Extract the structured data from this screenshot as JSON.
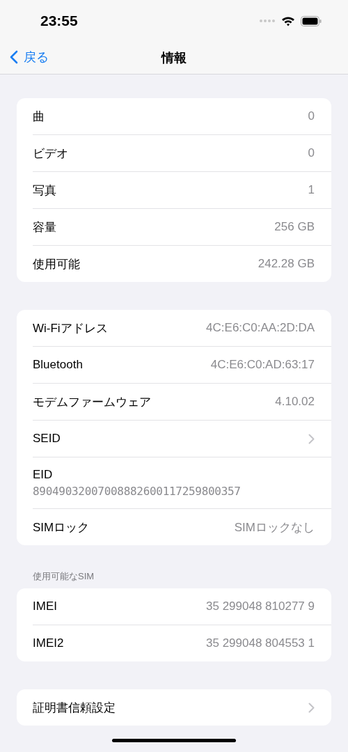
{
  "status_bar": {
    "time": "23:55"
  },
  "nav": {
    "back": "戻る",
    "title": "情報"
  },
  "groups": [
    {
      "rows": [
        {
          "kind": "value",
          "label": "曲",
          "value": "0"
        },
        {
          "kind": "value",
          "label": "ビデオ",
          "value": "0"
        },
        {
          "kind": "value",
          "label": "写真",
          "value": "1"
        },
        {
          "kind": "value",
          "label": "容量",
          "value": "256 GB"
        },
        {
          "kind": "value",
          "label": "使用可能",
          "value": "242.28 GB"
        }
      ]
    },
    {
      "rows": [
        {
          "kind": "value",
          "label": "Wi-Fiアドレス",
          "value": "4C:E6:C0:AA:2D:DA"
        },
        {
          "kind": "value",
          "label": "Bluetooth",
          "value": "4C:E6:C0:AD:63:17"
        },
        {
          "kind": "value",
          "label": "モデムファームウェア",
          "value": "4.10.02"
        },
        {
          "kind": "link",
          "label": "SEID"
        },
        {
          "kind": "stacked",
          "label": "EID",
          "value": "89049032007008882600117259800357"
        },
        {
          "kind": "value",
          "label": "SIMロック",
          "value": "SIMロックなし"
        }
      ]
    },
    {
      "header": "使用可能なSIM",
      "rows": [
        {
          "kind": "value",
          "label": "IMEI",
          "value": "35 299048 810277 9"
        },
        {
          "kind": "value",
          "label": "IMEI2",
          "value": "35 299048 804553 1"
        }
      ]
    },
    {
      "rows": [
        {
          "kind": "link",
          "label": "証明書信頼設定"
        }
      ]
    }
  ]
}
